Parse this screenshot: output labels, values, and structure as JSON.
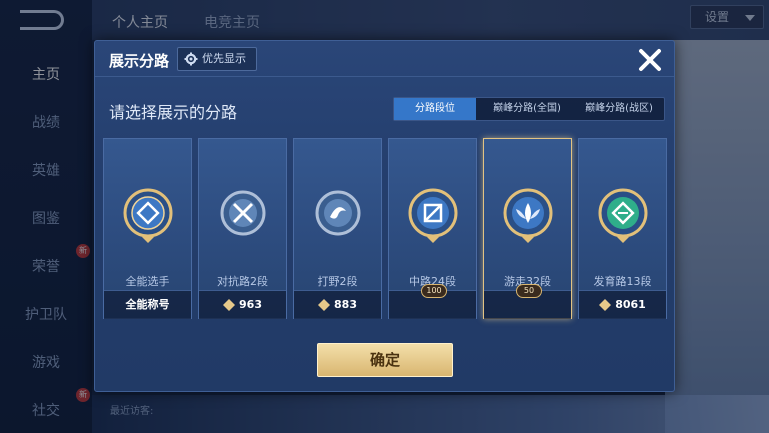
{
  "nav": {
    "items": [
      {
        "label": "主页",
        "active": true
      },
      {
        "label": "战绩"
      },
      {
        "label": "英雄"
      },
      {
        "label": "图鉴"
      },
      {
        "label": "荣誉",
        "badge": "新"
      },
      {
        "label": "护卫队"
      },
      {
        "label": "游戏"
      },
      {
        "label": "社交",
        "badge": "新"
      }
    ]
  },
  "top": {
    "tabs": [
      "个人主页",
      "电竞主页"
    ],
    "settings_label": "设置"
  },
  "bottom": {
    "text": "最近访客:"
  },
  "modal": {
    "title": "展示分路",
    "priority_label": "优先显示",
    "subtitle": "请选择展示的分路",
    "segments": [
      "分路段位",
      "巅峰分路(全国)",
      "巅峰分路(战区)"
    ],
    "active_segment": 0,
    "cards": [
      {
        "name": "全能选手",
        "footer": "全能称号",
        "emblem": "all-round-emblem",
        "tier": "gold"
      },
      {
        "name": "对抗路2段",
        "footer": "963",
        "emblem": "clash-lane-emblem",
        "tier": "silver"
      },
      {
        "name": "打野2段",
        "footer": "883",
        "emblem": "jungle-emblem",
        "tier": "silver"
      },
      {
        "name": "中路24段",
        "footer": "",
        "rank": "100",
        "emblem": "mid-lane-emblem",
        "tier": "gold"
      },
      {
        "name": "游走32段",
        "footer": "",
        "rank": "50",
        "emblem": "roam-emblem",
        "tier": "gold",
        "selected": true
      },
      {
        "name": "发育路13段",
        "footer": "8061",
        "emblem": "farm-lane-emblem",
        "tier": "gold"
      }
    ],
    "confirm_label": "确定"
  },
  "colors": {
    "accent": "#3577c9",
    "gold": "#d9b670",
    "panel": "#243e6d"
  }
}
